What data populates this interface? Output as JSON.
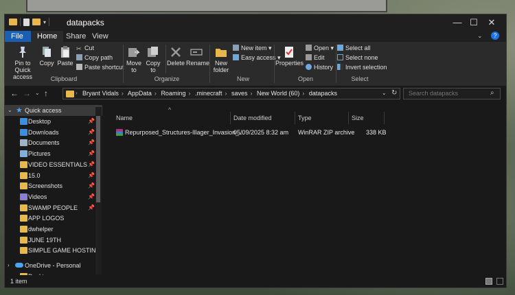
{
  "window": {
    "title": "datapacks",
    "controls": {
      "minimize": "—",
      "maximize": "☐",
      "close": "✕"
    }
  },
  "menu": {
    "tabs": [
      "File",
      "Home",
      "Share",
      "View"
    ]
  },
  "ribbon": {
    "clipboard": {
      "pin_label": "Pin to Quick access",
      "copy_label": "Copy",
      "paste_label": "Paste",
      "cut_label": "Cut",
      "copy_path_label": "Copy path",
      "paste_shortcut_label": "Paste shortcut",
      "group_label": "Clipboard"
    },
    "organize": {
      "move_to_label": "Move to",
      "copy_to_label": "Copy to",
      "delete_label": "Delete",
      "rename_label": "Rename",
      "group_label": "Organize"
    },
    "new": {
      "new_folder_label": "New folder",
      "new_item_label": "New item",
      "easy_access_label": "Easy access",
      "group_label": "New"
    },
    "open": {
      "properties_label": "Properties",
      "open_label": "Open",
      "edit_label": "Edit",
      "history_label": "History",
      "group_label": "Open"
    },
    "select": {
      "select_all_label": "Select all",
      "select_none_label": "Select none",
      "invert_label": "Invert selection",
      "group_label": "Select"
    }
  },
  "address": {
    "crumbs": [
      "Bryant Vidals",
      "AppData",
      "Roaming",
      ".minecraft",
      "saves",
      "New World (60)",
      "datapacks"
    ],
    "search_placeholder": "Search datapacks"
  },
  "nav": {
    "quick_access_label": "Quick access",
    "items": [
      {
        "label": "Desktop",
        "pinned": true,
        "icon": "desktop-icon"
      },
      {
        "label": "Downloads",
        "pinned": true,
        "icon": "downloads-icon"
      },
      {
        "label": "Documents",
        "pinned": true,
        "icon": "documents-icon"
      },
      {
        "label": "Pictures",
        "pinned": true,
        "icon": "pictures-icon"
      },
      {
        "label": "VIDEO ESSENTIALS",
        "pinned": true,
        "icon": "folder-icon"
      },
      {
        "label": "15.0",
        "pinned": true,
        "icon": "folder-icon"
      },
      {
        "label": "Screenshots",
        "pinned": true,
        "icon": "folder-icon"
      },
      {
        "label": "Videos",
        "pinned": true,
        "icon": "videos-icon"
      },
      {
        "label": "SWAMP PEOPLE",
        "pinned": true,
        "icon": "folder-icon"
      },
      {
        "label": "APP LOGOS",
        "pinned": false,
        "icon": "folder-icon"
      },
      {
        "label": "dwhelper",
        "pinned": false,
        "icon": "folder-icon"
      },
      {
        "label": "JUNE 19TH",
        "pinned": false,
        "icon": "folder-icon"
      },
      {
        "label": "SIMPLE GAME HOSTING",
        "pinned": false,
        "icon": "folder-icon"
      }
    ],
    "onedrive_label": "OneDrive - Personal",
    "onedrive_child_label": "Desktop",
    "pin_glyph": "📌"
  },
  "columns": {
    "name": "Name",
    "date": "Date modified",
    "type": "Type",
    "size": "Size"
  },
  "files": [
    {
      "name": "Repurposed_Structures-Illager_Invasion_...",
      "date": "05/09/2025 8:32 am",
      "type": "WinRAR ZIP archive",
      "size": "338 KB"
    }
  ],
  "status": {
    "count": "1 item"
  },
  "colors": {
    "accent": "#1a5fb4",
    "folder": "#e8b94a",
    "bg": "#191919"
  }
}
